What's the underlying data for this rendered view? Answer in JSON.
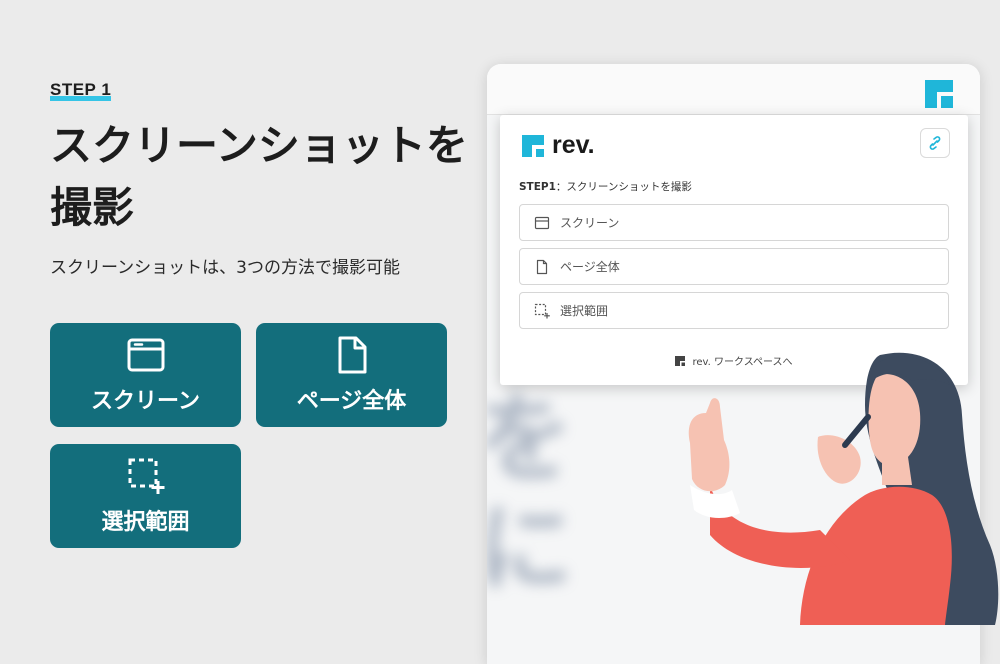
{
  "left": {
    "step_label": "STEP 1",
    "headline": "スクリーンショットを撮影",
    "subtext": "スクリーンショットは、3つの方法で撮影可能",
    "methods": [
      {
        "label": "スクリーン",
        "icon": "browser-window-icon"
      },
      {
        "label": "ページ全体",
        "icon": "document-icon"
      },
      {
        "label": "選択範囲",
        "icon": "selection-area-icon"
      }
    ]
  },
  "popup": {
    "logo_text": "rev.",
    "step_prefix": "STEP1",
    "step_text": "：スクリーンショットを撮影",
    "options": [
      {
        "label": "スクリーン",
        "icon": "browser-window-icon"
      },
      {
        "label": "ページ全体",
        "icon": "document-icon"
      },
      {
        "label": "選択範囲",
        "icon": "selection-area-icon"
      }
    ],
    "footer_link": "rev. ワークスペースへ"
  },
  "background_blur_text": "を\nに",
  "colors": {
    "accent_teal": "#136e7c",
    "brand_cyan": "#1fb6d9",
    "step_underline": "#35c4e6",
    "figure_shirt": "#ef5f55",
    "figure_hair": "#3d4b5f"
  }
}
